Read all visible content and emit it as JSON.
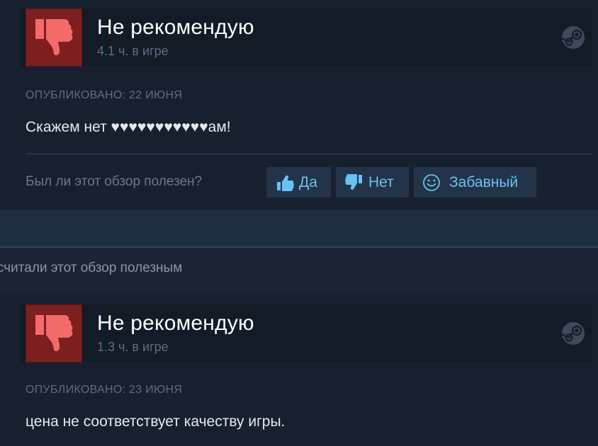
{
  "reviews": [
    {
      "recommendation": "Не рекомендую",
      "hours": "4.1 ч. в игре",
      "posted": "ОПУБЛИКОВАНО: 22 ИЮНЯ",
      "text": "Скажем нет ♥♥♥♥♥♥♥♥♥♥♥ам!",
      "helpful_question": "Был ли этот обзор полезен?",
      "buttons": {
        "yes": "Да",
        "no": "Нет",
        "funny": "Забавный"
      }
    },
    {
      "recommendation": "Не рекомендую",
      "hours": "1.3 ч. в игре",
      "posted": "ОПУБЛИКОВАНО: 23 ИЮНЯ",
      "text": "цена не соответствует качеству игры."
    }
  ],
  "found_helpful_text": "считали этот обзор полезным",
  "icons": {
    "thumb": "thumbs-down-icon",
    "platform": "steam-icon",
    "yes": "thumbs-up-icon",
    "no": "thumbs-down-icon",
    "funny": "smiley-icon"
  },
  "colors": {
    "thumb_down_bg": "#7d1f1f",
    "thumb_down_fg": "#f26a6a",
    "button_text": "#67c1f5",
    "button_bg": "#243448"
  }
}
